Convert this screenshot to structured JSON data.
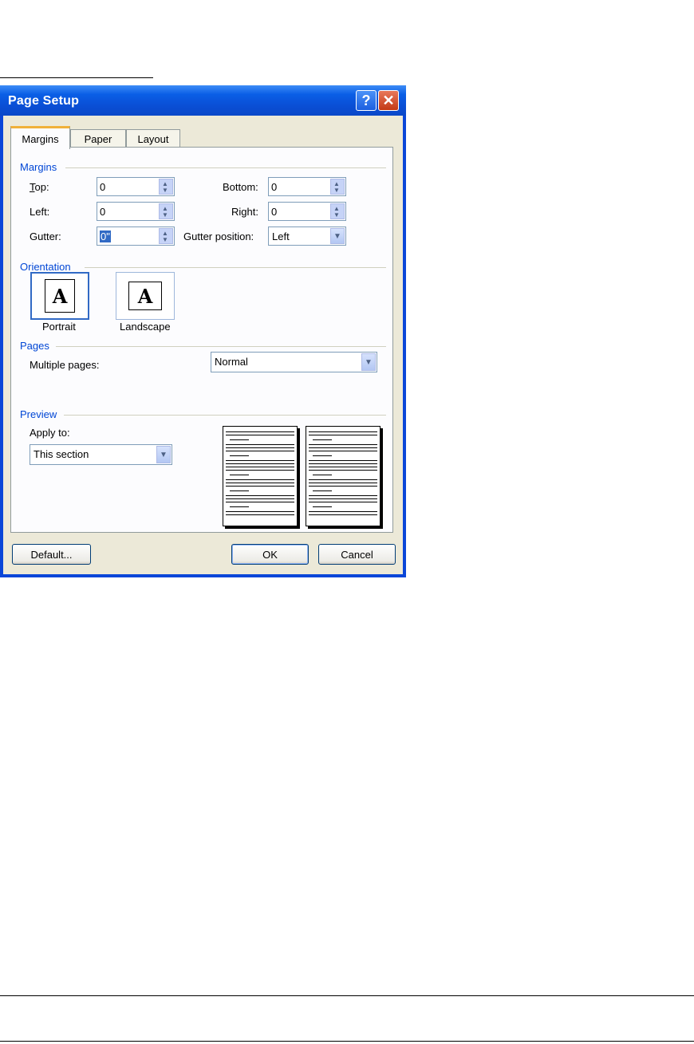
{
  "dialog": {
    "title": "Page Setup",
    "help_icon": "help-icon",
    "close_icon": "close-icon",
    "tabs": [
      {
        "label": "Margins",
        "active": true
      },
      {
        "label": "Paper",
        "active": false
      },
      {
        "label": "Layout",
        "active": false
      }
    ],
    "margins": {
      "group_label": "Margins",
      "top": {
        "label": "Top:",
        "value": "0"
      },
      "left": {
        "label": "Left:",
        "value": "0"
      },
      "gutter": {
        "label": "Gutter:",
        "value": "0\""
      },
      "bottom": {
        "label": "Bottom:",
        "value": "0"
      },
      "right": {
        "label": "Right:",
        "value": "0"
      },
      "gutter_position": {
        "label": "Gutter position:",
        "value": "Left"
      }
    },
    "orientation": {
      "group_label": "Orientation",
      "portrait_label": "Portrait",
      "landscape_label": "Landscape",
      "icon_glyph": "A",
      "selected": "Portrait"
    },
    "pages": {
      "group_label": "Pages",
      "multiple_label": "Multiple pages:",
      "multiple_value": "Normal"
    },
    "preview": {
      "group_label": "Preview",
      "apply_label": "Apply to:",
      "apply_value": "This section"
    },
    "buttons": {
      "default": "Default...",
      "ok": "OK",
      "cancel": "Cancel"
    }
  }
}
